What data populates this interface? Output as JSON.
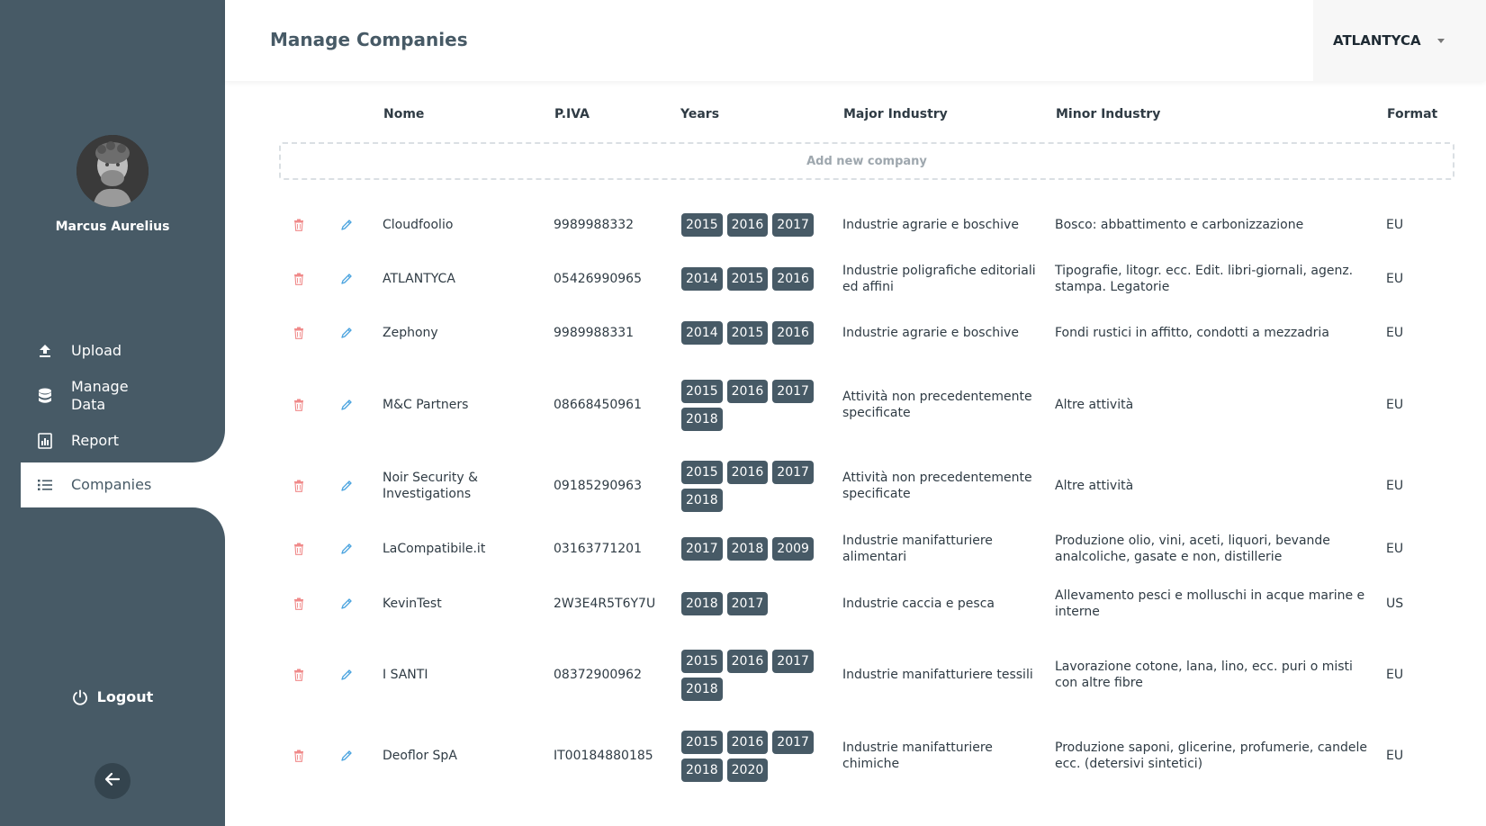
{
  "app": {
    "page_title": "Manage Companies",
    "selected_company": "ATLANTYCA"
  },
  "user": {
    "name": "Marcus Aurelius"
  },
  "sidebar": {
    "items": [
      {
        "label": "Upload",
        "icon": "upload-icon"
      },
      {
        "label": "Manage Data",
        "icon": "database-icon"
      },
      {
        "label": "Report",
        "icon": "report-icon"
      },
      {
        "label": "Companies",
        "icon": "list-icon",
        "active": true
      }
    ],
    "logout_label": "Logout"
  },
  "colors": {
    "sidebar": "#475a66",
    "badge": "#475a66",
    "delete": "#f08a8a",
    "edit": "#4aa3df"
  },
  "table": {
    "columns": {
      "name": "Nome",
      "piva": "P.IVA",
      "years": "Years",
      "major": "Major Industry",
      "minor": "Minor Industry",
      "format": "Format"
    },
    "add_new_label": "Add new company",
    "rows": [
      {
        "name": "Cloudfoolio",
        "piva": "9989988332",
        "years": [
          "2015",
          "2016",
          "2017"
        ],
        "major": "Industrie agrarie e boschive",
        "minor": "Bosco: abbattimento e carbonizzazione",
        "format": "EU"
      },
      {
        "name": "ATLANTYCA",
        "piva": "05426990965",
        "years": [
          "2014",
          "2015",
          "2016"
        ],
        "major": "Industrie poligrafiche editoriali ed affini",
        "minor": "Tipografie, litogr. ecc. Edit. libri-giornali, agenz. stampa. Legatorie",
        "format": "EU"
      },
      {
        "name": "Zephony",
        "piva": "9989988331",
        "years": [
          "2014",
          "2015",
          "2016"
        ],
        "major": "Industrie agrarie e boschive",
        "minor": "Fondi rustici in affitto, condotti a mezzadria",
        "format": "EU"
      },
      {
        "name": "M&C Partners",
        "piva": "08668450961",
        "years": [
          "2015",
          "2016",
          "2017",
          "2018"
        ],
        "major": "Attività non precedentemente specificate",
        "minor": "Altre attività",
        "format": "EU"
      },
      {
        "name": "Noir Security & Investigations",
        "piva": "09185290963",
        "years": [
          "2015",
          "2016",
          "2017",
          "2018"
        ],
        "major": "Attività non precedentemente specificate",
        "minor": "Altre attività",
        "format": "EU"
      },
      {
        "name": "LaCompatibile.it",
        "piva": "03163771201",
        "years": [
          "2017",
          "2018",
          "2009"
        ],
        "major": "Industrie manifatturiere alimentari",
        "minor": "Produzione olio, vini, aceti, liquori, bevande analcoliche, gasate e non, distillerie",
        "format": "EU"
      },
      {
        "name": "KevinTest",
        "piva": "2W3E4R5T6Y7U",
        "years": [
          "2018",
          "2017"
        ],
        "major": "Industrie caccia e pesca",
        "minor": "Allevamento pesci e molluschi in acque marine e interne",
        "format": "US"
      },
      {
        "name": "I SANTI",
        "piva": "08372900962",
        "years": [
          "2015",
          "2016",
          "2017",
          "2018"
        ],
        "major": "Industrie manifatturiere tessili",
        "minor": "Lavorazione cotone, lana, lino, ecc. puri o misti con altre fibre",
        "format": "EU"
      },
      {
        "name": "Deoflor SpA",
        "piva": "IT00184880185",
        "years": [
          "2015",
          "2016",
          "2017",
          "2018",
          "2020"
        ],
        "major": "Industrie manifatturiere chimiche",
        "minor": "Produzione saponi, glicerine, profumerie, candele ecc. (detersivi sintetici)",
        "format": "EU"
      }
    ]
  }
}
